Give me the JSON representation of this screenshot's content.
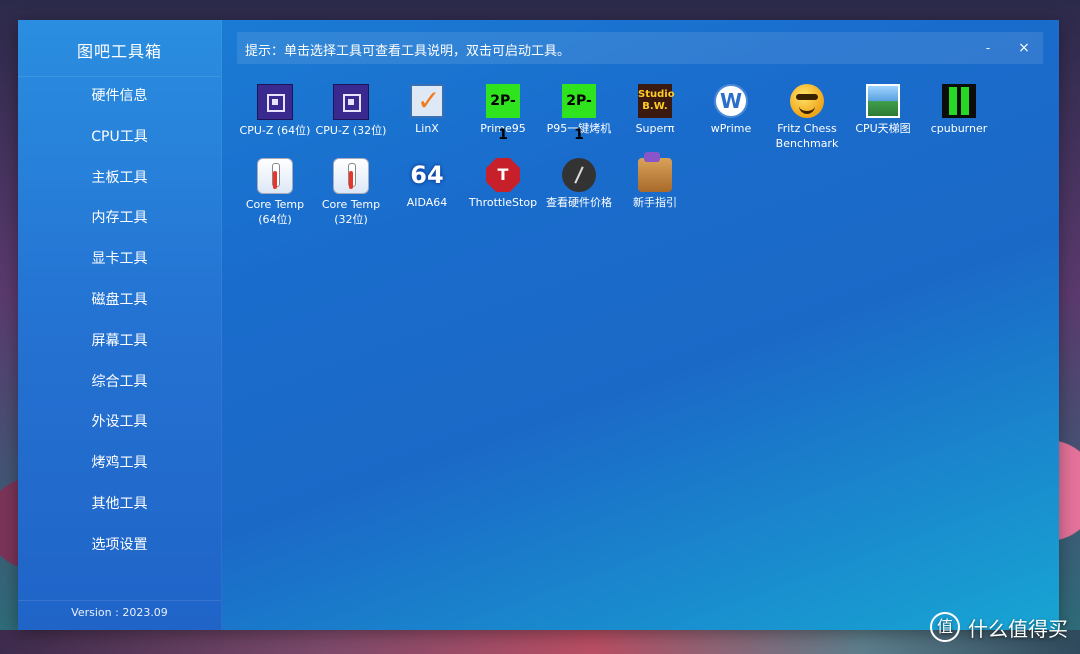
{
  "app": {
    "title": "图吧工具箱",
    "version": "Version : 2023.09"
  },
  "hint": {
    "text": "提示：单击选择工具可查看工具说明，双击可启动工具。"
  },
  "window_controls": {
    "minimize": "-",
    "close": "×"
  },
  "sidebar": {
    "items": [
      {
        "label": "硬件信息"
      },
      {
        "label": "CPU工具"
      },
      {
        "label": "主板工具"
      },
      {
        "label": "内存工具"
      },
      {
        "label": "显卡工具"
      },
      {
        "label": "磁盘工具"
      },
      {
        "label": "屏幕工具"
      },
      {
        "label": "综合工具"
      },
      {
        "label": "外设工具"
      },
      {
        "label": "烤鸡工具"
      },
      {
        "label": "其他工具"
      },
      {
        "label": "选项设置"
      }
    ]
  },
  "tools": [
    {
      "label": "CPU-Z (64位)",
      "icon": "cpuz-icon",
      "icon_text": ""
    },
    {
      "label": "CPU-Z (32位)",
      "icon": "cpuz-icon",
      "icon_text": ""
    },
    {
      "label": "LinX",
      "icon": "linx-icon",
      "icon_text": ""
    },
    {
      "label": "Prime95",
      "icon": "prime95-icon",
      "icon_text": "2P-1"
    },
    {
      "label": "P95一键烤机",
      "icon": "prime95-icon",
      "icon_text": "2P-1"
    },
    {
      "label": "Superπ",
      "icon": "superpi-icon",
      "icon_text": "Studio B.W."
    },
    {
      "label": "wPrime",
      "icon": "wprime-icon",
      "icon_text": "W"
    },
    {
      "label": "Fritz Chess\nBenchmark",
      "icon": "fritz-face-icon",
      "icon_text": ""
    },
    {
      "label": "CPU天梯图",
      "icon": "landscape-picture-icon",
      "icon_text": ""
    },
    {
      "label": "cpuburner",
      "icon": "cpuburner-icon",
      "icon_text": ""
    },
    {
      "label": "Core Temp\n(64位)",
      "icon": "thermometer-icon",
      "icon_text": ""
    },
    {
      "label": "Core Temp\n(32位)",
      "icon": "thermometer-icon",
      "icon_text": ""
    },
    {
      "label": "AIDA64",
      "icon": "aida64-icon",
      "icon_text": "64"
    },
    {
      "label": "ThrottleStop",
      "icon": "stop-sign-icon",
      "icon_text": "T"
    },
    {
      "label": "查看硬件价格",
      "icon": "price-dial-icon",
      "icon_text": ""
    },
    {
      "label": "新手指引",
      "icon": "guide-box-icon",
      "icon_text": ""
    }
  ],
  "watermark": {
    "text": "什么值得买"
  }
}
